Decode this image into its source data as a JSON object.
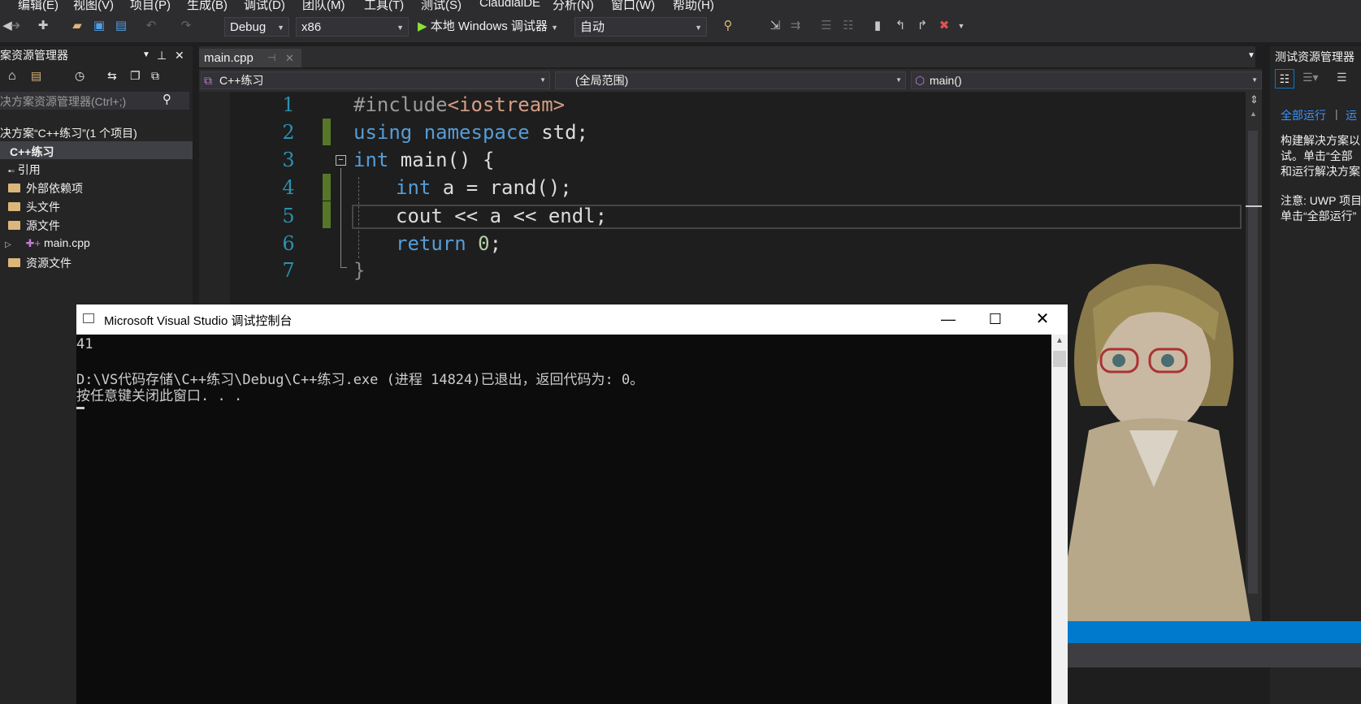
{
  "menu": [
    "编辑(E)",
    "视图(V)",
    "项目(P)",
    "生成(B)",
    "调试(D)",
    "团队(M)",
    "工具(T)",
    "测试(S)",
    "ClaudialDE",
    "分析(N)",
    "窗口(W)",
    "帮助(H)"
  ],
  "toolbar": {
    "config": "Debug",
    "platform": "x86",
    "run_label": "本地 Windows 调试器",
    "mode": "自动"
  },
  "solution_explorer": {
    "title": "案资源管理器",
    "search_placeholder": "决方案资源管理器(Ctrl+;)",
    "solution": "决方案“C++练习”(1 个项目)",
    "project": "C++练习",
    "items": [
      "引用",
      "外部依赖项",
      "头文件",
      "源文件",
      "main.cpp",
      "资源文件"
    ]
  },
  "editor": {
    "tab": "main.cpp",
    "nav_project": "C++练习",
    "nav_scope": "(全局范围)",
    "nav_member": "main()",
    "line_numbers": [
      "1",
      "2",
      "3",
      "4",
      "5",
      "6",
      "7"
    ],
    "lines": {
      "l1_pp": "#include",
      "l1_hdr": "<iostream>",
      "l2_kw1": "using",
      "l2_kw2": "namespace",
      "l2_rest": " std;",
      "l3_kw": "int",
      "l3_rest": " main() {",
      "l4_kw": "int",
      "l4_rest": " a = rand();",
      "l5": "cout << a << endl;",
      "l6_kw": "return",
      "l6_num": "0",
      "l6_rest": ";",
      "l7": "}"
    }
  },
  "test_explorer": {
    "title": "测试资源管理器",
    "run_all": "全部运行",
    "run_more": "运",
    "desc1": "构建解决方案以",
    "desc2": "试。单击“全部",
    "desc3": "和运行解决方案",
    "note1": "注意: UWP 项目",
    "note2": "单击“全部运行”"
  },
  "console": {
    "title": "Microsoft Visual Studio 调试控制台",
    "line1": "41",
    "line2": "D:\\VS代码存储\\C++练习\\Debug\\C++练习.exe (进程 14824)已退出，返回代码为: 0。",
    "line3": "按任意键关闭此窗口. . ."
  },
  "colors": {
    "accent": "#007acc",
    "keyword": "#569cd6",
    "change_marker": "#577728"
  }
}
